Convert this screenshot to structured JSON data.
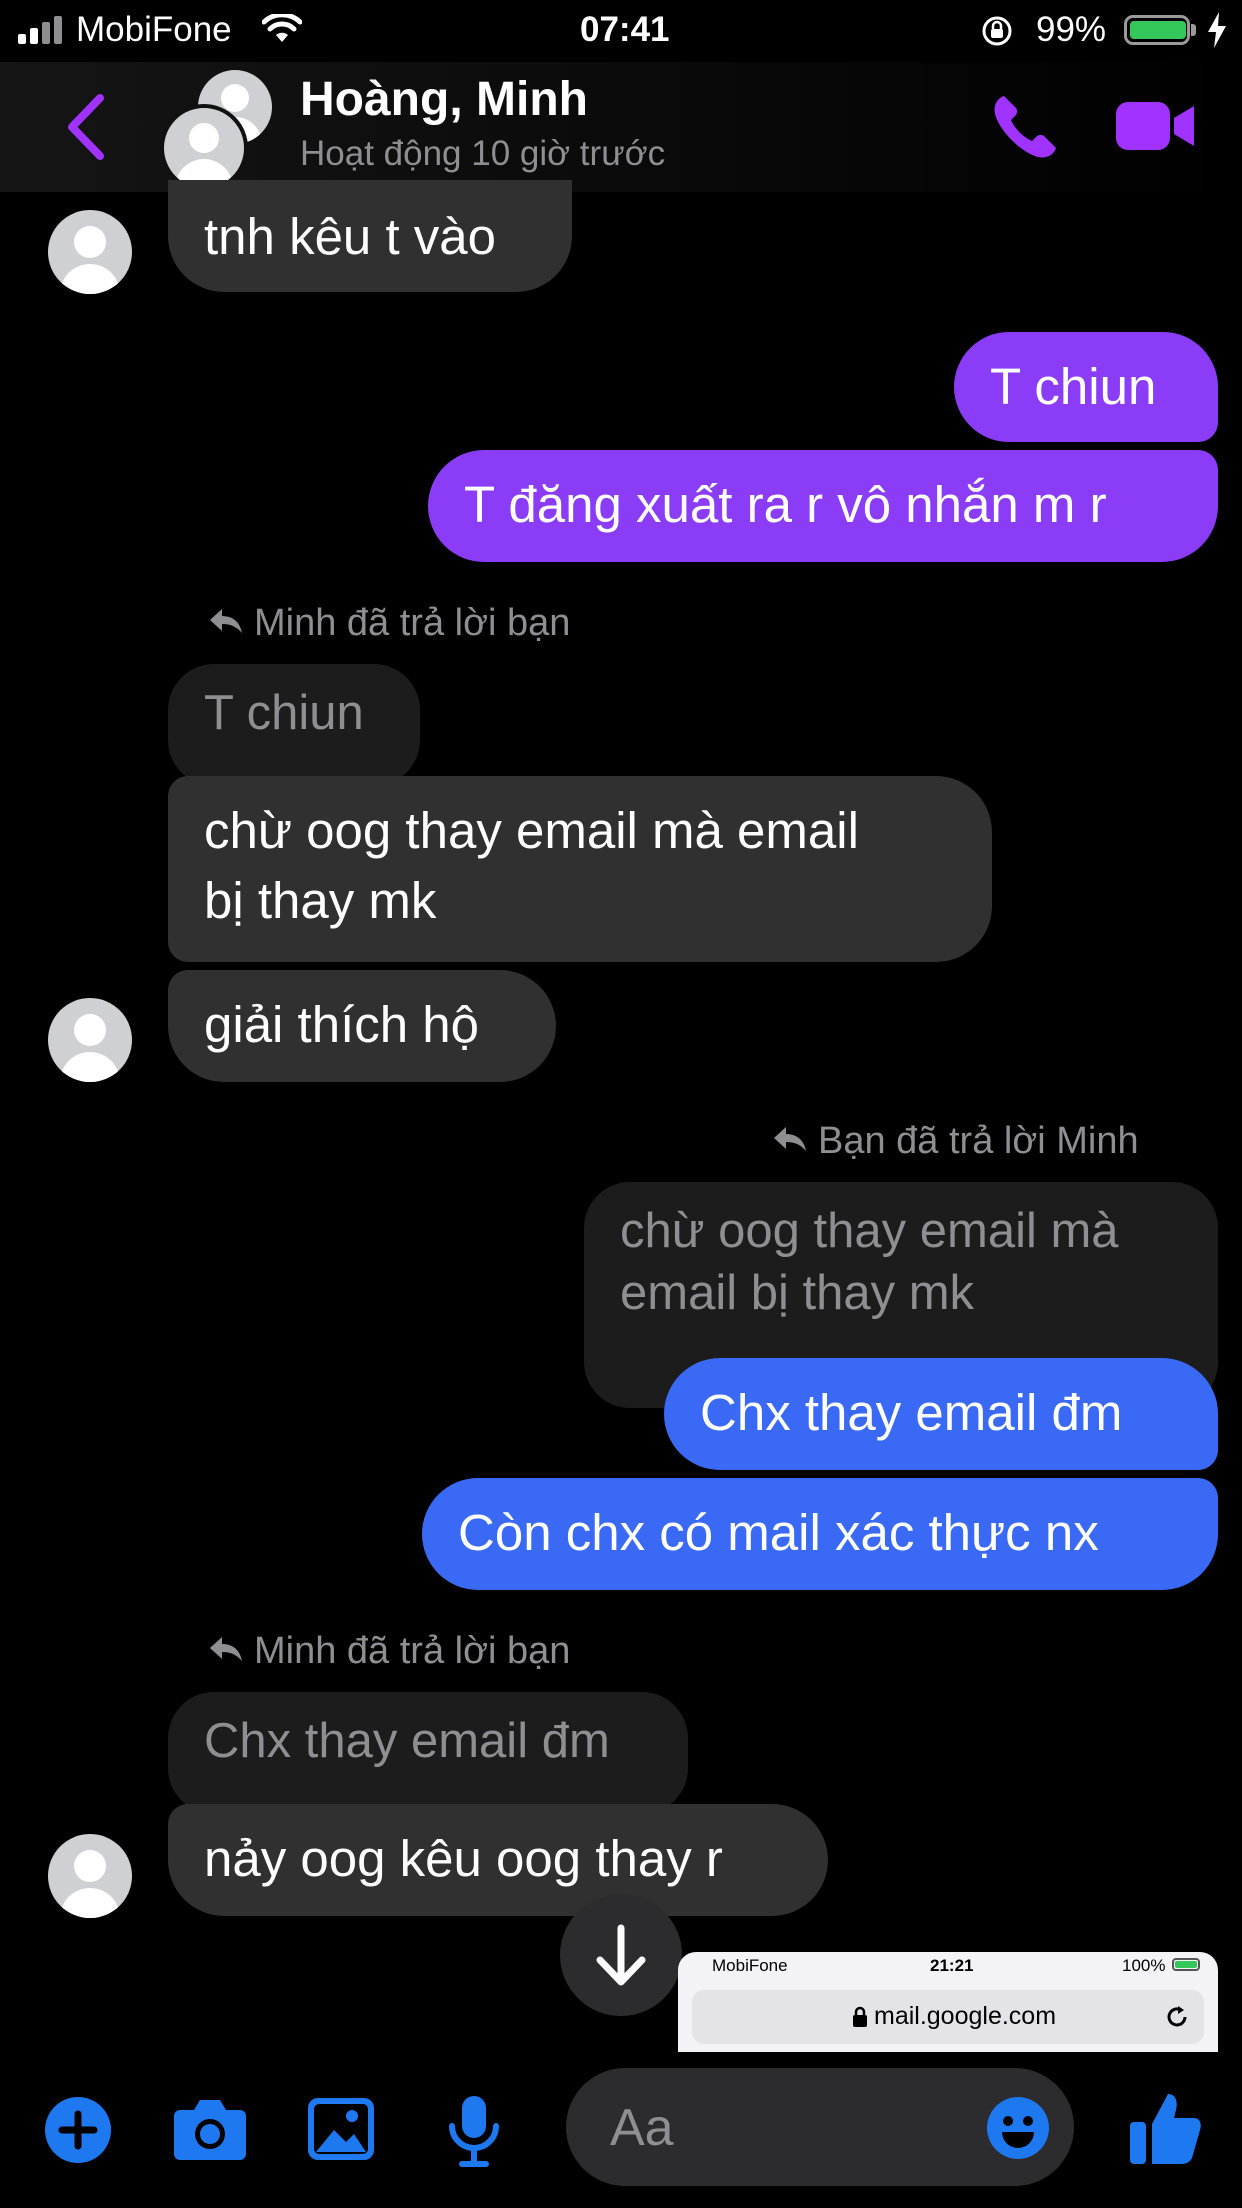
{
  "status_bar": {
    "carrier": "MobiFone",
    "time": "07:41",
    "battery_percent": "99%",
    "battery_level": 0.99,
    "battery_color": "#34c759"
  },
  "header": {
    "name": "Hoàng, Minh",
    "status": "Hoạt động 10 giờ trước",
    "accent_color": "#a033ff",
    "icons": [
      "back-icon",
      "phone-icon",
      "video-icon"
    ]
  },
  "messages": {
    "m1": "tnh kêu t vào",
    "m2": "T chiun",
    "m3": "T đăng xuất ra r vô nhắn m r",
    "reply1_label": "Minh đã trả lời bạn",
    "reply1_quote": "T chiun",
    "m4_line1": "chừ oog thay email mà email",
    "m4_line2": "bị thay mk",
    "m5": "giải thích hộ",
    "reply2_label": "Bạn đã trả lời Minh",
    "reply2_quote_line1": "chừ oog thay email mà",
    "reply2_quote_line2": "email bị thay mk",
    "m6": "Chx thay email đm",
    "m7": "Còn chx có mail xác thực nx",
    "reply3_label": "Minh đã trả lời bạn",
    "reply3_quote": "Chx thay email đm",
    "m8": "nảy oog kêu oog thay r"
  },
  "colors": {
    "incoming_bubble": "#303030",
    "outgoing_purple": "#8b3cf7",
    "outgoing_blue": "#3a6af5"
  },
  "composer": {
    "placeholder": "Aa"
  },
  "toolbar": {
    "icons": [
      "plus-icon",
      "camera-icon",
      "image-icon",
      "microphone-icon",
      "emoji-icon",
      "thumbs-up-icon"
    ]
  },
  "pip": {
    "carrier": "MobiFone",
    "time": "21:21",
    "battery": "100%",
    "url": "mail.google.com"
  }
}
